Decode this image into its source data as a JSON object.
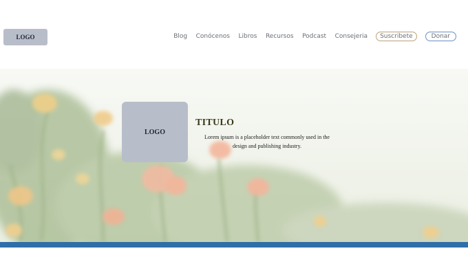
{
  "header": {
    "logo": "LOGO",
    "nav": [
      "Blog",
      "Conócenos",
      "Libros",
      "Recursos",
      "Podcast",
      "Consejeria"
    ],
    "subscribe": "Suscribete",
    "donate": "Donar"
  },
  "hero": {
    "logo": "LOGO",
    "title": "TITULO",
    "text": "Lorem ipsum is a placeholder text commonly used in the design and publishing industry."
  },
  "colors": {
    "accent_blue": "#2f6ea8",
    "logo_box": "#b8bec9",
    "subscribe_border": "#b8a37a",
    "donate_border": "#6a90c4"
  }
}
